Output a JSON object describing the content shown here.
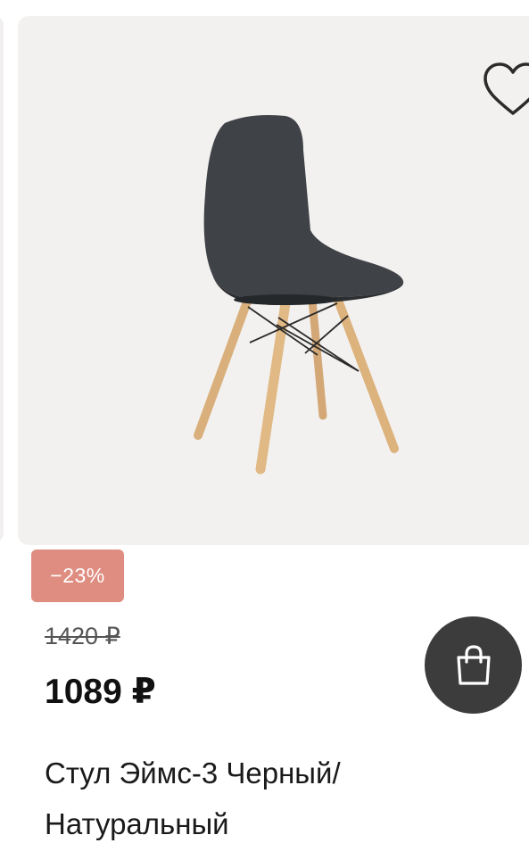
{
  "product": {
    "discount_badge": "−23%",
    "old_price": "1420 ₽",
    "price": "1089 ₽",
    "title": "Стул Эймс-3 Черный/ Натуральный",
    "image_icon": "chair-photo"
  },
  "icons": {
    "favorite": "heart-icon",
    "cart": "shopping-bag-icon"
  },
  "colors": {
    "badge_bg": "#df8d81",
    "cart_button_bg": "#3c3c3c",
    "image_bg": "#f3f1f0"
  }
}
